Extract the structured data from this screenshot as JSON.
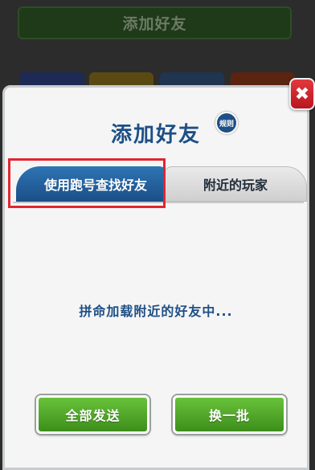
{
  "background": {
    "top_button_label": "添加好友"
  },
  "dialog": {
    "title": "添加好友",
    "rules_badge": "规则",
    "close_glyph": "✖",
    "tabs": [
      {
        "label": "使用跑号查找好友",
        "active": true
      },
      {
        "label": "附近的玩家",
        "active": false
      }
    ],
    "loading_text": "拼命加载附近的好友中...",
    "buttons": {
      "send_all": "全部发送",
      "refresh": "换一批"
    }
  },
  "colors": {
    "title_blue": "#1e4f86",
    "button_green": "#4fa82a",
    "close_red": "#d0232b",
    "highlight_red": "#e0262f"
  }
}
